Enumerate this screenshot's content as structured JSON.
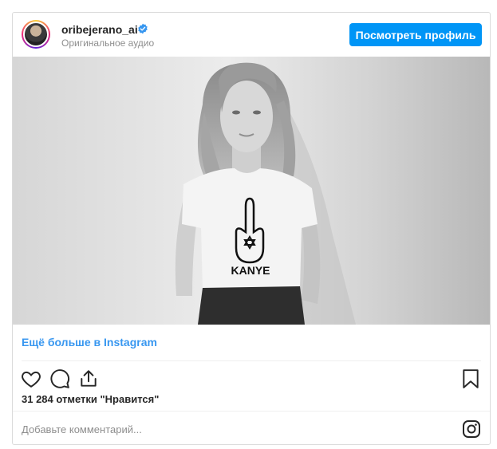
{
  "header": {
    "username": "oribejerano_ai",
    "subtitle": "Оригинальное аудио",
    "profile_button": "Посмотреть профиль",
    "verified": true
  },
  "post": {
    "shirt_text": "KANYE"
  },
  "footer": {
    "more_link": "Ещё больше в Instagram",
    "likes": "31 284 отметки \"Нравится\"",
    "comment_placeholder": "Добавьте комментарий..."
  },
  "icons": {
    "like": "heart-icon",
    "comment": "comment-icon",
    "share": "share-icon",
    "save": "bookmark-icon",
    "instagram": "instagram-icon",
    "verified": "verified-badge-icon"
  },
  "colors": {
    "accent": "#0095f6",
    "link": "#3897f0",
    "verified": "#3897f0"
  }
}
